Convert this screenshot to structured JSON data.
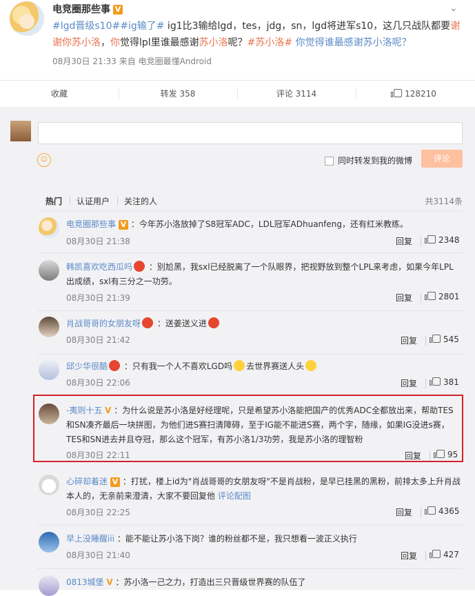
{
  "post": {
    "author": "电竞圈那些事",
    "content_parts": [
      {
        "t": "#lgd晋级s10##ig输了#",
        "c": "topic"
      },
      {
        "t": " ig1比3输给lgd，tes，jdg，sn，lgd将进军s10，这几只战队都要",
        "c": "plain"
      },
      {
        "t": "谢谢你苏小洛",
        "c": "link"
      },
      {
        "t": "，",
        "c": "plain"
      },
      {
        "t": "你",
        "c": "link"
      },
      {
        "t": "觉得lpl里谁最感谢",
        "c": "plain"
      },
      {
        "t": "苏小洛",
        "c": "link"
      },
      {
        "t": "呢？",
        "c": "plain"
      },
      {
        "t": "#苏小洛#",
        "c": "link"
      },
      {
        "t": " ",
        "c": "plain"
      },
      {
        "t": "你觉得谁最感谢苏小洛呢？",
        "c": "topic"
      }
    ],
    "meta": "08月30日 21:33  来自 电竞圈最懂Android"
  },
  "actions": {
    "favorite": "收藏",
    "repost": "转发 358",
    "comment": "评论 3114",
    "like": "128210"
  },
  "compose": {
    "forward_label": "同时转发到我的微博",
    "submit_label": "评论"
  },
  "filters": {
    "hot": "热门",
    "verified": "认证用户",
    "following": "关注的人",
    "total": "共3114条"
  },
  "comments": [
    {
      "name": "电竞圈那些事",
      "badge": "V",
      "text": "：今年苏小洛放掉了S8冠军ADC，LDL冠军ADhuanfeng，还有红米教练。",
      "time": "08月30日 21:38",
      "reply": "回复",
      "likes": "2348"
    },
    {
      "name": "韩凯喜欢吃西瓜吗",
      "badge": "crown",
      "text": "：别尬黑，我sxl已经脱离了一个队眼界，把视野放到整个LPL来考虑，如果今年LPL出成绩，sxl有三分之一功劳。",
      "time": "08月30日 21:39",
      "reply": "回复",
      "likes": "2801"
    },
    {
      "name": "肖战哥哥的女朋友呀",
      "badge": "crown",
      "text": "：送姜送义进",
      "time": "08月30日 21:42",
      "reply": "回复",
      "likes": "545"
    },
    {
      "name": "邱少华很酷",
      "badge": "crown",
      "text": "：只有我一个人不喜欢LGD吗",
      "text2": "去世界赛送人头",
      "time": "08月30日 22:06",
      "reply": "回复",
      "likes": "381"
    },
    {
      "name": "-夷则十五",
      "badge": "V",
      "text": "：为什么说是苏小洛是好经理呢，只是希望苏小洛能把国产的优秀ADC全都放出来，帮助TES和SN凑齐最后一块拼图，为他们进S赛扫清障碍，至于IG能不能进S赛，两个字，随缘，如果IG没进s赛，TES和SN进去并且夺冠，那么这个冠军，有苏小洛1/3功劳，我是苏小洛的理智粉",
      "time": "08月30日 22:11",
      "reply": "回复",
      "likes": "95"
    },
    {
      "name": "心碎却着迷",
      "badge": "V",
      "text": "：打扰，楼上id为\"肖战哥哥的女朋友呀\"不是肖战粉，是早已挂黑的黑粉，前排太多上升肖战本人的，无亲前来澄清，大家不要回复他",
      "text_link": " 评论配图",
      "time": "08月30日 22:25",
      "reply": "回复",
      "likes": "4365"
    },
    {
      "name": "早上没睡醒iii",
      "badge": "",
      "text": "：能不能让苏小洛下岗？谁的粉丝都不是，我只想看一波正义执行",
      "time": "08月30日 21:40",
      "reply": "回复",
      "likes": "427"
    },
    {
      "name": "0813城堡",
      "badge": "V",
      "text": "：苏小洛一己之力，打造出三只晋级世界赛的队伍了",
      "time": "",
      "reply": "",
      "likes": ""
    }
  ]
}
